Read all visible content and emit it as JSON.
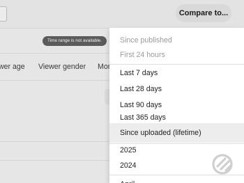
{
  "header": {
    "compare_button_label": "Compare to..."
  },
  "notice": {
    "text": "Time range is not available."
  },
  "tabs": [
    {
      "label": "wer age"
    },
    {
      "label": "Viewer gender"
    },
    {
      "label": "Mor"
    }
  ],
  "date_range_menu": {
    "items": [
      {
        "label": "Since published",
        "enabled": false
      },
      {
        "label": "First 24 hours",
        "enabled": false
      },
      {
        "label": "Last 7 days",
        "enabled": true
      },
      {
        "label": "Last 28 days",
        "enabled": true
      },
      {
        "label": "Last 90 days",
        "enabled": true
      },
      {
        "label": "Last 365 days",
        "enabled": true
      },
      {
        "label": "Since uploaded (lifetime)",
        "enabled": true,
        "selected": true
      },
      {
        "label": "2025",
        "enabled": true
      },
      {
        "label": "2024",
        "enabled": true
      },
      {
        "label": "April",
        "enabled": true
      }
    ]
  },
  "watermark": {
    "icon": "logo-watermark-icon"
  },
  "colors": {
    "overlay_background": "#e6e6e6",
    "menu_background": "#ffffff",
    "selected_row": "#ededed",
    "disabled_text": "#9a9a9a",
    "badge_background": "#5b5b5b"
  }
}
